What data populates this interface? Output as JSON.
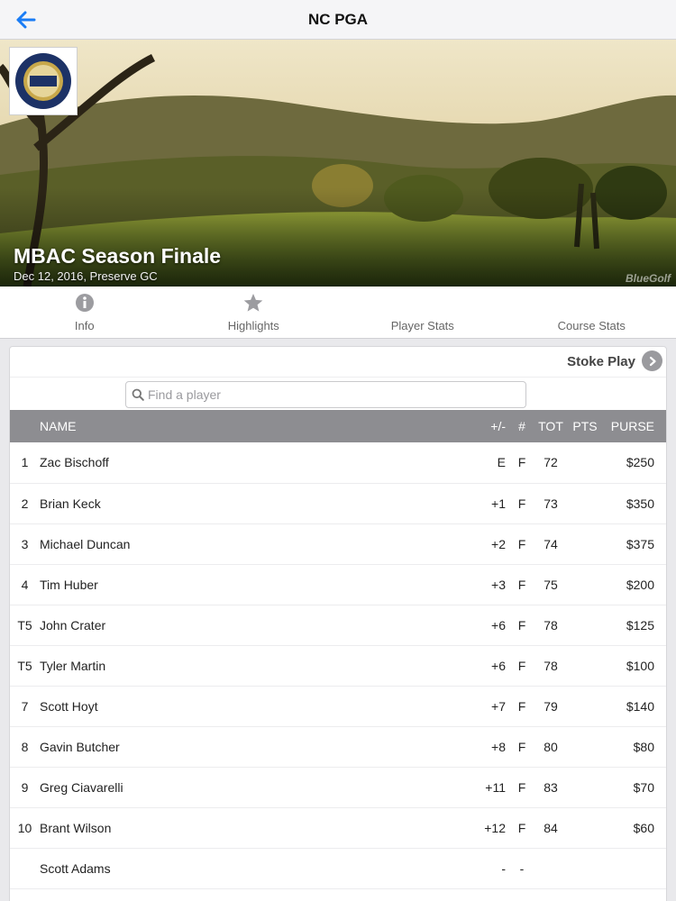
{
  "navbar": {
    "title": "NC PGA",
    "back_icon": "back-arrow-icon",
    "back_color": "#1a7cf5"
  },
  "hero": {
    "logo_icon": "pga-logo-icon",
    "title": "MBAC Season Finale",
    "subtitle": "Dec 12, 2016, Preserve GC",
    "watermark": "BlueGolf"
  },
  "tabs": [
    {
      "label": "Info",
      "icon": "info-icon"
    },
    {
      "label": "Highlights",
      "icon": "star-icon"
    },
    {
      "label": "Player Stats",
      "icon": ""
    },
    {
      "label": "Course Stats",
      "icon": ""
    }
  ],
  "leaderboard": {
    "format_label": "Stoke Play",
    "search_placeholder": "Find a player",
    "search_value": "",
    "header_color": "#8d8d91",
    "columns": {
      "pos": "",
      "name": "NAME",
      "plus_minus": "+/-",
      "hole": "#",
      "tot": "TOT",
      "pts": "PTS",
      "purse": "PURSE"
    },
    "rows": [
      {
        "pos": "1",
        "name": "Zac Bischoff",
        "plus_minus": "E",
        "hole": "F",
        "tot": "72",
        "pts": "",
        "purse": "$250"
      },
      {
        "pos": "2",
        "name": "Brian Keck",
        "plus_minus": "+1",
        "hole": "F",
        "tot": "73",
        "pts": "",
        "purse": "$350"
      },
      {
        "pos": "3",
        "name": "Michael Duncan",
        "plus_minus": "+2",
        "hole": "F",
        "tot": "74",
        "pts": "",
        "purse": "$375"
      },
      {
        "pos": "4",
        "name": "Tim Huber",
        "plus_minus": "+3",
        "hole": "F",
        "tot": "75",
        "pts": "",
        "purse": "$200"
      },
      {
        "pos": "T5",
        "name": "John Crater",
        "plus_minus": "+6",
        "hole": "F",
        "tot": "78",
        "pts": "",
        "purse": "$125"
      },
      {
        "pos": "T5",
        "name": "Tyler Martin",
        "plus_minus": "+6",
        "hole": "F",
        "tot": "78",
        "pts": "",
        "purse": "$100"
      },
      {
        "pos": "7",
        "name": "Scott Hoyt",
        "plus_minus": "+7",
        "hole": "F",
        "tot": "79",
        "pts": "",
        "purse": "$140"
      },
      {
        "pos": "8",
        "name": "Gavin Butcher",
        "plus_minus": "+8",
        "hole": "F",
        "tot": "80",
        "pts": "",
        "purse": "$80"
      },
      {
        "pos": "9",
        "name": "Greg Ciavarelli",
        "plus_minus": "+11",
        "hole": "F",
        "tot": "83",
        "pts": "",
        "purse": "$70"
      },
      {
        "pos": "10",
        "name": "Brant Wilson",
        "plus_minus": "+12",
        "hole": "F",
        "tot": "84",
        "pts": "",
        "purse": "$60"
      },
      {
        "pos": "",
        "name": "Scott Adams",
        "plus_minus": "-",
        "hole": "-",
        "tot": "",
        "pts": "",
        "purse": ""
      }
    ]
  }
}
